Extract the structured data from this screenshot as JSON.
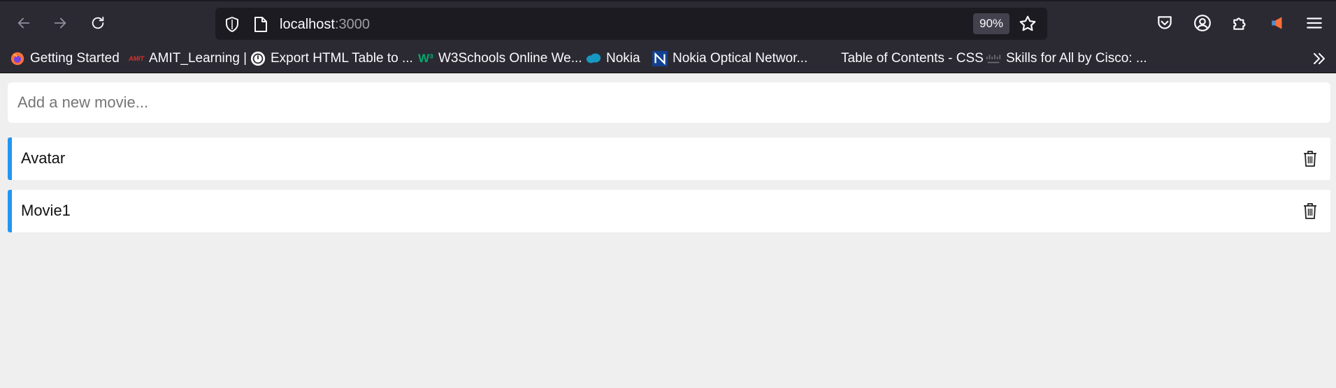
{
  "browser": {
    "url_host": "localhost",
    "url_port": ":3000",
    "zoom": "90%",
    "bookmarks": [
      {
        "label": "Getting Started",
        "icon": "firefox-icon"
      },
      {
        "label": "AMIT_Learning |",
        "icon": "amit-icon"
      },
      {
        "label": "Export HTML Table to ...",
        "icon": "export-table-icon"
      },
      {
        "label": "W3Schools Online We...",
        "icon": "w3schools-icon"
      },
      {
        "label": "Nokia",
        "icon": "salesforce-cloud-icon"
      },
      {
        "label": "Nokia Optical Networ...",
        "icon": "nokia-icon"
      },
      {
        "label": "Table of Contents - CSS",
        "icon": "blank-page-icon"
      },
      {
        "label": "Skills for All by Cisco: ...",
        "icon": "cisco-icon"
      }
    ]
  },
  "app": {
    "new_movie_placeholder": "Add a new movie...",
    "accent_color": "#2196f3",
    "movies": [
      {
        "title": "Avatar"
      },
      {
        "title": "Movie1"
      }
    ]
  }
}
